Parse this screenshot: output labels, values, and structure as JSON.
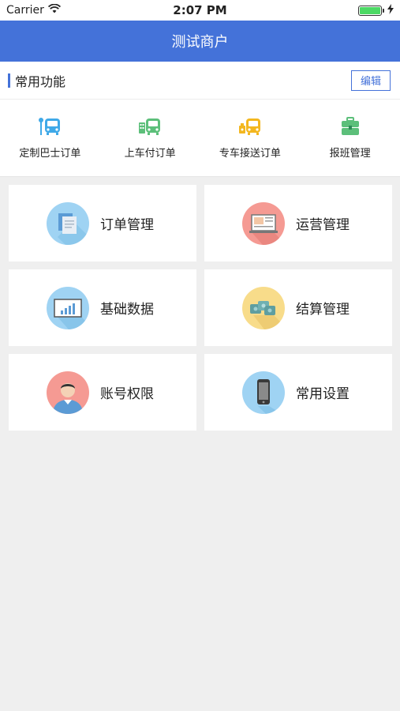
{
  "status": {
    "carrier": "Carrier",
    "time": "2:07 PM"
  },
  "header": {
    "title": "测试商户"
  },
  "section": {
    "title": "常用功能",
    "edit_label": "编辑"
  },
  "quick": [
    {
      "label": "定制巴士订单",
      "icon": "bus-stop-icon",
      "color": "#3fa9e8"
    },
    {
      "label": "上车付订单",
      "icon": "bus-pay-icon",
      "color": "#5cbf7a"
    },
    {
      "label": "专车接送订单",
      "icon": "car-shuttle-icon",
      "color": "#f3b71f"
    },
    {
      "label": "报班管理",
      "icon": "toolbox-icon",
      "color": "#5cbf7a"
    }
  ],
  "modules": [
    {
      "label": "订单管理",
      "icon": "documents-icon",
      "bg": "#9fd3f3"
    },
    {
      "label": "运营管理",
      "icon": "laptop-chart-icon",
      "bg": "#f59a93"
    },
    {
      "label": "基础数据",
      "icon": "monitor-chart-icon",
      "bg": "#9fd3f3"
    },
    {
      "label": "结算管理",
      "icon": "money-stack-icon",
      "bg": "#f8dc8a"
    },
    {
      "label": "账号权限",
      "icon": "user-avatar-icon",
      "bg": "#f59a93"
    },
    {
      "label": "常用设置",
      "icon": "phone-icon",
      "bg": "#9fd3f3"
    }
  ]
}
